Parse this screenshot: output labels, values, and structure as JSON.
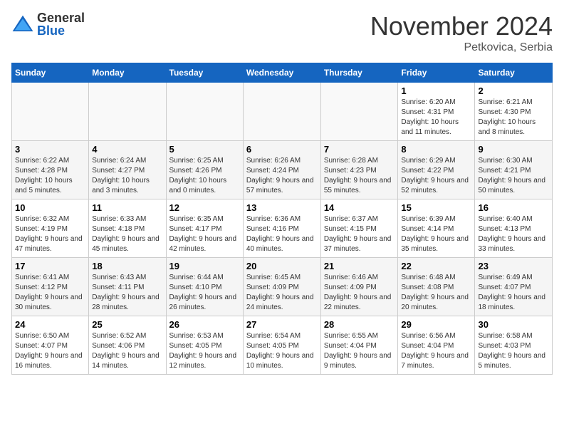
{
  "logo": {
    "general": "General",
    "blue": "Blue"
  },
  "title": "November 2024",
  "location": "Petkovica, Serbia",
  "weekdays": [
    "Sunday",
    "Monday",
    "Tuesday",
    "Wednesday",
    "Thursday",
    "Friday",
    "Saturday"
  ],
  "weeks": [
    [
      {
        "day": "",
        "info": ""
      },
      {
        "day": "",
        "info": ""
      },
      {
        "day": "",
        "info": ""
      },
      {
        "day": "",
        "info": ""
      },
      {
        "day": "",
        "info": ""
      },
      {
        "day": "1",
        "info": "Sunrise: 6:20 AM\nSunset: 4:31 PM\nDaylight: 10 hours and 11 minutes."
      },
      {
        "day": "2",
        "info": "Sunrise: 6:21 AM\nSunset: 4:30 PM\nDaylight: 10 hours and 8 minutes."
      }
    ],
    [
      {
        "day": "3",
        "info": "Sunrise: 6:22 AM\nSunset: 4:28 PM\nDaylight: 10 hours and 5 minutes."
      },
      {
        "day": "4",
        "info": "Sunrise: 6:24 AM\nSunset: 4:27 PM\nDaylight: 10 hours and 3 minutes."
      },
      {
        "day": "5",
        "info": "Sunrise: 6:25 AM\nSunset: 4:26 PM\nDaylight: 10 hours and 0 minutes."
      },
      {
        "day": "6",
        "info": "Sunrise: 6:26 AM\nSunset: 4:24 PM\nDaylight: 9 hours and 57 minutes."
      },
      {
        "day": "7",
        "info": "Sunrise: 6:28 AM\nSunset: 4:23 PM\nDaylight: 9 hours and 55 minutes."
      },
      {
        "day": "8",
        "info": "Sunrise: 6:29 AM\nSunset: 4:22 PM\nDaylight: 9 hours and 52 minutes."
      },
      {
        "day": "9",
        "info": "Sunrise: 6:30 AM\nSunset: 4:21 PM\nDaylight: 9 hours and 50 minutes."
      }
    ],
    [
      {
        "day": "10",
        "info": "Sunrise: 6:32 AM\nSunset: 4:19 PM\nDaylight: 9 hours and 47 minutes."
      },
      {
        "day": "11",
        "info": "Sunrise: 6:33 AM\nSunset: 4:18 PM\nDaylight: 9 hours and 45 minutes."
      },
      {
        "day": "12",
        "info": "Sunrise: 6:35 AM\nSunset: 4:17 PM\nDaylight: 9 hours and 42 minutes."
      },
      {
        "day": "13",
        "info": "Sunrise: 6:36 AM\nSunset: 4:16 PM\nDaylight: 9 hours and 40 minutes."
      },
      {
        "day": "14",
        "info": "Sunrise: 6:37 AM\nSunset: 4:15 PM\nDaylight: 9 hours and 37 minutes."
      },
      {
        "day": "15",
        "info": "Sunrise: 6:39 AM\nSunset: 4:14 PM\nDaylight: 9 hours and 35 minutes."
      },
      {
        "day": "16",
        "info": "Sunrise: 6:40 AM\nSunset: 4:13 PM\nDaylight: 9 hours and 33 minutes."
      }
    ],
    [
      {
        "day": "17",
        "info": "Sunrise: 6:41 AM\nSunset: 4:12 PM\nDaylight: 9 hours and 30 minutes."
      },
      {
        "day": "18",
        "info": "Sunrise: 6:43 AM\nSunset: 4:11 PM\nDaylight: 9 hours and 28 minutes."
      },
      {
        "day": "19",
        "info": "Sunrise: 6:44 AM\nSunset: 4:10 PM\nDaylight: 9 hours and 26 minutes."
      },
      {
        "day": "20",
        "info": "Sunrise: 6:45 AM\nSunset: 4:09 PM\nDaylight: 9 hours and 24 minutes."
      },
      {
        "day": "21",
        "info": "Sunrise: 6:46 AM\nSunset: 4:09 PM\nDaylight: 9 hours and 22 minutes."
      },
      {
        "day": "22",
        "info": "Sunrise: 6:48 AM\nSunset: 4:08 PM\nDaylight: 9 hours and 20 minutes."
      },
      {
        "day": "23",
        "info": "Sunrise: 6:49 AM\nSunset: 4:07 PM\nDaylight: 9 hours and 18 minutes."
      }
    ],
    [
      {
        "day": "24",
        "info": "Sunrise: 6:50 AM\nSunset: 4:07 PM\nDaylight: 9 hours and 16 minutes."
      },
      {
        "day": "25",
        "info": "Sunrise: 6:52 AM\nSunset: 4:06 PM\nDaylight: 9 hours and 14 minutes."
      },
      {
        "day": "26",
        "info": "Sunrise: 6:53 AM\nSunset: 4:05 PM\nDaylight: 9 hours and 12 minutes."
      },
      {
        "day": "27",
        "info": "Sunrise: 6:54 AM\nSunset: 4:05 PM\nDaylight: 9 hours and 10 minutes."
      },
      {
        "day": "28",
        "info": "Sunrise: 6:55 AM\nSunset: 4:04 PM\nDaylight: 9 hours and 9 minutes."
      },
      {
        "day": "29",
        "info": "Sunrise: 6:56 AM\nSunset: 4:04 PM\nDaylight: 9 hours and 7 minutes."
      },
      {
        "day": "30",
        "info": "Sunrise: 6:58 AM\nSunset: 4:03 PM\nDaylight: 9 hours and 5 minutes."
      }
    ]
  ]
}
